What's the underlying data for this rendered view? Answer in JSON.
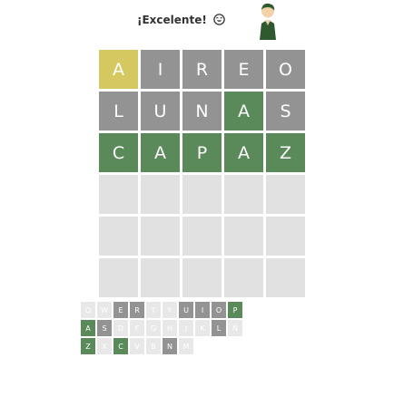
{
  "header": {
    "status_text": "¡Excelente!",
    "smiley_icon": "smiley-face-icon",
    "avatar_icon": "person-avatar-icon"
  },
  "colors": {
    "correct": "#5a8a5a",
    "present": "#d5c860",
    "absent": "#939393",
    "empty": "#e1e1e1",
    "key_default": "#d6d6d6"
  },
  "board": {
    "rows": [
      [
        {
          "letter": "A",
          "state": "present"
        },
        {
          "letter": "I",
          "state": "absent"
        },
        {
          "letter": "R",
          "state": "absent"
        },
        {
          "letter": "E",
          "state": "absent"
        },
        {
          "letter": "O",
          "state": "absent"
        }
      ],
      [
        {
          "letter": "L",
          "state": "absent"
        },
        {
          "letter": "U",
          "state": "absent"
        },
        {
          "letter": "N",
          "state": "absent"
        },
        {
          "letter": "A",
          "state": "correct"
        },
        {
          "letter": "S",
          "state": "absent"
        }
      ],
      [
        {
          "letter": "C",
          "state": "correct"
        },
        {
          "letter": "A",
          "state": "correct"
        },
        {
          "letter": "P",
          "state": "correct"
        },
        {
          "letter": "A",
          "state": "correct"
        },
        {
          "letter": "Z",
          "state": "correct"
        }
      ],
      [
        {
          "letter": "",
          "state": "empty"
        },
        {
          "letter": "",
          "state": "empty"
        },
        {
          "letter": "",
          "state": "empty"
        },
        {
          "letter": "",
          "state": "empty"
        },
        {
          "letter": "",
          "state": "empty"
        }
      ],
      [
        {
          "letter": "",
          "state": "empty"
        },
        {
          "letter": "",
          "state": "empty"
        },
        {
          "letter": "",
          "state": "empty"
        },
        {
          "letter": "",
          "state": "empty"
        },
        {
          "letter": "",
          "state": "empty"
        }
      ],
      [
        {
          "letter": "",
          "state": "empty"
        },
        {
          "letter": "",
          "state": "empty"
        },
        {
          "letter": "",
          "state": "empty"
        },
        {
          "letter": "",
          "state": "empty"
        },
        {
          "letter": "",
          "state": "empty"
        }
      ]
    ]
  },
  "keyboard": {
    "rows": [
      [
        {
          "k": "Q",
          "s": "lit"
        },
        {
          "k": "W",
          "s": "lit"
        },
        {
          "k": "E",
          "s": "absent"
        },
        {
          "k": "R",
          "s": "absent"
        },
        {
          "k": "T",
          "s": "lit"
        },
        {
          "k": "Y",
          "s": "lit"
        },
        {
          "k": "U",
          "s": "absent"
        },
        {
          "k": "I",
          "s": "absent"
        },
        {
          "k": "O",
          "s": "absent"
        },
        {
          "k": "P",
          "s": "correct"
        }
      ],
      [
        {
          "k": "A",
          "s": "correct"
        },
        {
          "k": "S",
          "s": "absent"
        },
        {
          "k": "D",
          "s": "lit"
        },
        {
          "k": "F",
          "s": "lit"
        },
        {
          "k": "G",
          "s": "lit"
        },
        {
          "k": "H",
          "s": "lit"
        },
        {
          "k": "J",
          "s": "lit"
        },
        {
          "k": "K",
          "s": "lit"
        },
        {
          "k": "L",
          "s": "absent"
        },
        {
          "k": "Ñ",
          "s": "lit"
        }
      ],
      [
        {
          "k": "Z",
          "s": "correct"
        },
        {
          "k": "X",
          "s": "lit"
        },
        {
          "k": "C",
          "s": "correct"
        },
        {
          "k": "V",
          "s": "lit"
        },
        {
          "k": "B",
          "s": "lit"
        },
        {
          "k": "N",
          "s": "absent"
        },
        {
          "k": "M",
          "s": "lit"
        }
      ]
    ]
  }
}
